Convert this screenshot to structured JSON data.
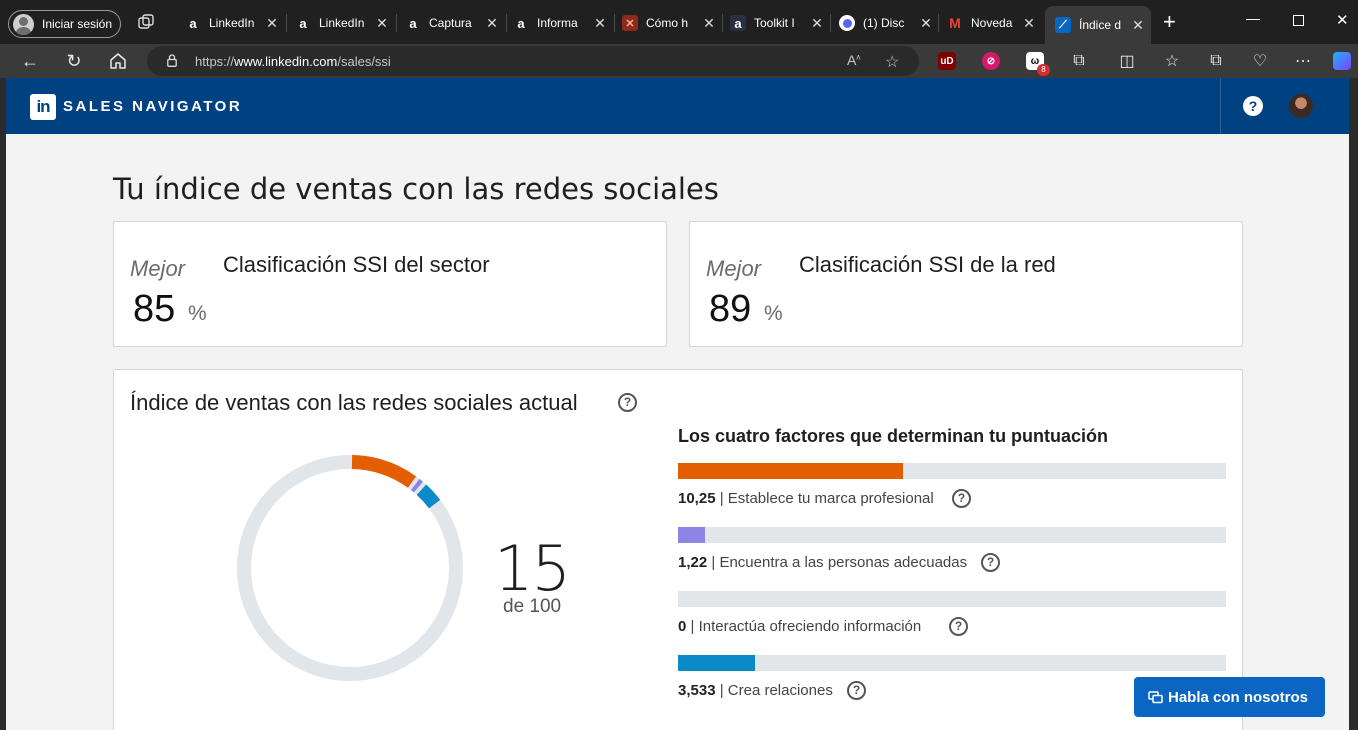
{
  "browser": {
    "profile_label": "Iniciar sesión",
    "tabs": [
      {
        "title": "LinkedIn",
        "icon": "a-icon"
      },
      {
        "title": "LinkedIn",
        "icon": "a-icon"
      },
      {
        "title": "Captura",
        "icon": "a-icon"
      },
      {
        "title": "Informa",
        "icon": "a-icon"
      },
      {
        "title": "Cómo h",
        "icon": "x-icon"
      },
      {
        "title": "Toolkit I",
        "icon": "a-icon"
      },
      {
        "title": "(1) Disc",
        "icon": "chrome-icon"
      },
      {
        "title": "Noveda",
        "icon": "gmail-icon"
      },
      {
        "title": "Índice d",
        "icon": "compass-icon"
      }
    ],
    "url_prefix": "https://",
    "url_host": "www.linkedin.com",
    "url_path": "/sales/ssi",
    "extension_badge": "8"
  },
  "header": {
    "logo_text": "in",
    "product_name": "SALES NAVIGATOR",
    "help_symbol": "?"
  },
  "page": {
    "title": "Tu índice de ventas con las redes sociales",
    "rankings": [
      {
        "qualifier": "Mejor",
        "label": "Clasificación SSI del sector",
        "value": "85",
        "unit": "%"
      },
      {
        "qualifier": "Mejor",
        "label": "Clasificación SSI de la red",
        "value": "89",
        "unit": "%"
      }
    ],
    "ssi": {
      "title": "Índice de ventas con las redes sociales actual",
      "score": "15",
      "score_of": "de 100",
      "factors_title": "Los cuatro factores que determinan tu puntuación",
      "factors": [
        {
          "value": "10,25",
          "label": "| Establece tu marca profesional",
          "fraction": 0.41,
          "color": "#e35e00"
        },
        {
          "value": "1,22",
          "label": "| Encuentra a las personas adecuadas",
          "fraction": 0.049,
          "color": "#8c85e6"
        },
        {
          "value": "0",
          "label": "| Interactúa ofreciendo información",
          "fraction": 0.0,
          "color": "#2f9a57"
        },
        {
          "value": "3,533",
          "label": "| Crea relaciones",
          "fraction": 0.141,
          "color": "#0a8ac9"
        }
      ]
    },
    "chat_button": "Habla con nosotros"
  }
}
